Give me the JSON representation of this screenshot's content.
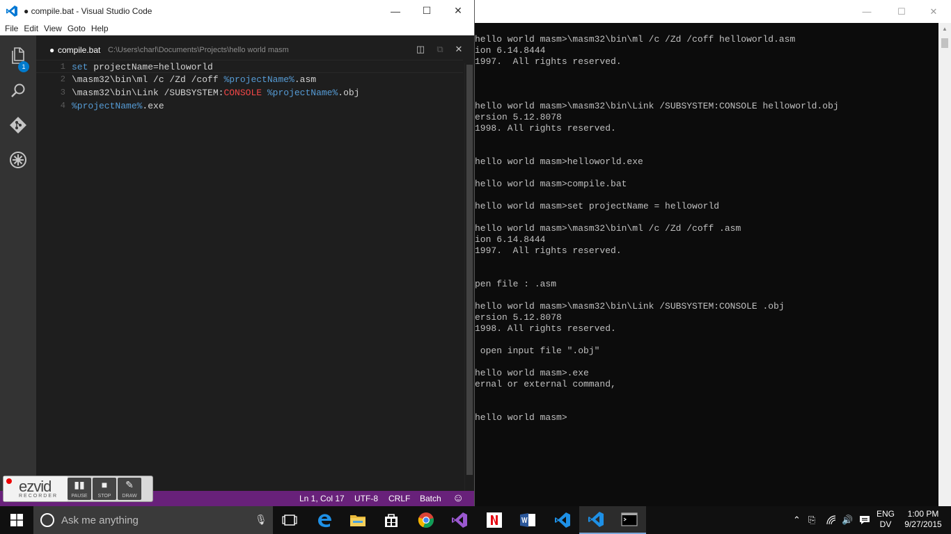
{
  "vscode": {
    "window_title": "● compile.bat - Visual Studio Code",
    "menu": [
      "File",
      "Edit",
      "View",
      "Goto",
      "Help"
    ],
    "explorer_badge": "1",
    "tab": {
      "dirty_marker": "●",
      "filename": "compile.bat",
      "path": "C:\\Users\\charl\\Documents\\Projects\\hello world masm"
    },
    "code_lines": [
      {
        "num": "1",
        "parts": [
          [
            "kw",
            "set"
          ],
          [
            "plain",
            " projectName=helloworld"
          ]
        ]
      },
      {
        "num": "2",
        "parts": [
          [
            "plain",
            "\\masm32\\bin\\ml /c /Zd /coff "
          ],
          [
            "var",
            "%projectName%"
          ],
          [
            "plain",
            ".asm"
          ]
        ]
      },
      {
        "num": "3",
        "parts": [
          [
            "plain",
            "\\masm32\\bin\\Link /SUBSYSTEM:"
          ],
          [
            "const",
            "CONSOLE"
          ],
          [
            "plain",
            " "
          ],
          [
            "var",
            "%projectName%"
          ],
          [
            "plain",
            ".obj"
          ]
        ]
      },
      {
        "num": "4",
        "parts": [
          [
            "var",
            "%projectName%"
          ],
          [
            "plain",
            ".exe"
          ]
        ]
      }
    ],
    "status": {
      "position": "Ln 1, Col 17",
      "encoding": "UTF-8",
      "eol": "CRLF",
      "language": "Batch",
      "feedback_icon": "☺"
    },
    "accent_status_color": "#68217a"
  },
  "ezvid": {
    "logo": "ezvid",
    "sub": "RECORDER",
    "buttons": [
      {
        "label": "PAUSE",
        "glyph": "▮▮"
      },
      {
        "label": "STOP",
        "glyph": "■"
      },
      {
        "label": "DRAW",
        "glyph": "✎"
      }
    ]
  },
  "console": {
    "lines": [
      {
        "row": 1,
        "text": "hello world masm>\\masm32\\bin\\ml /c /Zd /coff helloworld.asm"
      },
      {
        "row": 2,
        "text": "ion 6.14.8444"
      },
      {
        "row": 3,
        "text": "1997.  All rights reserved."
      },
      {
        "row": 7,
        "text": "hello world masm>\\masm32\\bin\\Link /SUBSYSTEM:CONSOLE helloworld.obj"
      },
      {
        "row": 8,
        "text": "ersion 5.12.8078"
      },
      {
        "row": 9,
        "text": "1998. All rights reserved."
      },
      {
        "row": 12,
        "text": "hello world masm>helloworld.exe"
      },
      {
        "row": 14,
        "text": "hello world masm>compile.bat"
      },
      {
        "row": 16,
        "text": "hello world masm>set projectName = helloworld"
      },
      {
        "row": 18,
        "text": "hello world masm>\\masm32\\bin\\ml /c /Zd /coff .asm"
      },
      {
        "row": 19,
        "text": "ion 6.14.8444"
      },
      {
        "row": 20,
        "text": "1997.  All rights reserved."
      },
      {
        "row": 23,
        "text": "pen file : .asm"
      },
      {
        "row": 25,
        "text": "hello world masm>\\masm32\\bin\\Link /SUBSYSTEM:CONSOLE .obj"
      },
      {
        "row": 26,
        "text": "ersion 5.12.8078"
      },
      {
        "row": 27,
        "text": "1998. All rights reserved."
      },
      {
        "row": 29,
        "text": " open input file \".obj\""
      },
      {
        "row": 31,
        "text": "hello world masm>.exe"
      },
      {
        "row": 32,
        "text": "ernal or external command,"
      },
      {
        "row": 35,
        "text": "hello world masm>"
      }
    ]
  },
  "taskbar": {
    "search_placeholder": "Ask me anything",
    "language": "ENG",
    "keyboard": "DV",
    "time": "1:00 PM",
    "date": "9/27/2015"
  }
}
